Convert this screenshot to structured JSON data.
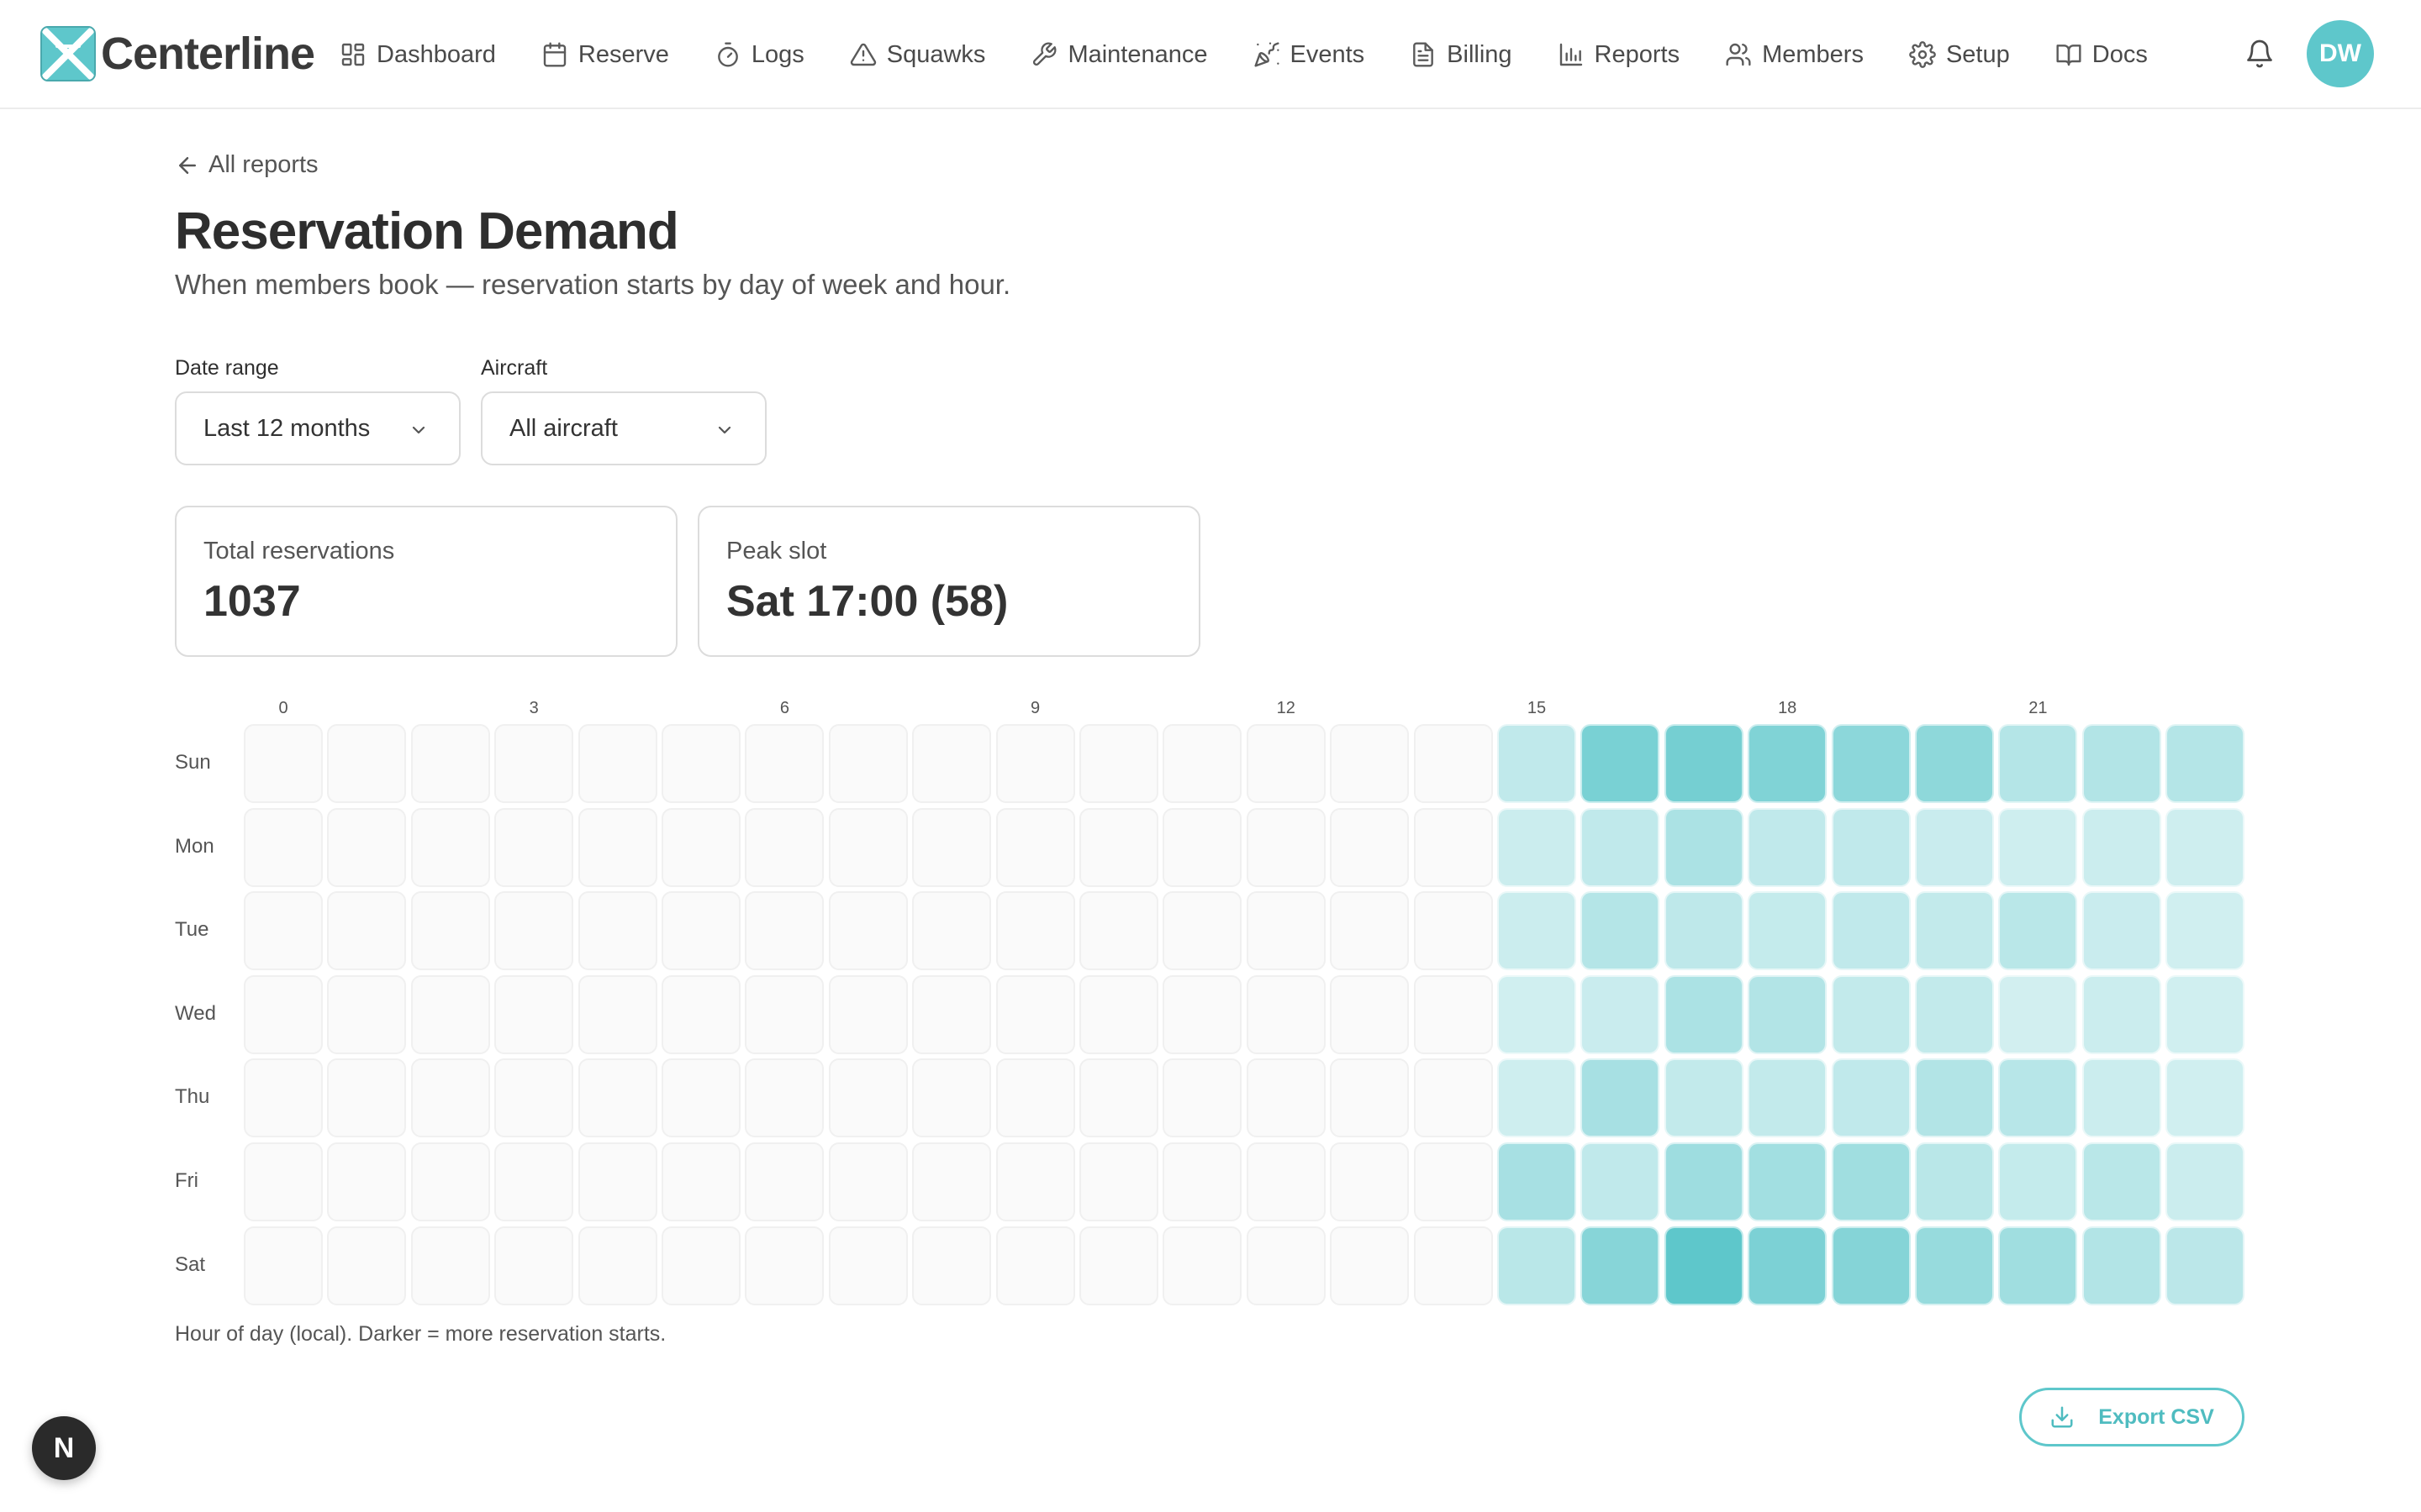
{
  "brand": {
    "name": "Centerline",
    "accent": "#5ec7cb"
  },
  "nav": {
    "items": [
      {
        "label": "Dashboard",
        "icon": "grid-icon"
      },
      {
        "label": "Reserve",
        "icon": "calendar-icon"
      },
      {
        "label": "Logs",
        "icon": "stopwatch-icon"
      },
      {
        "label": "Squawks",
        "icon": "warning-triangle-icon"
      },
      {
        "label": "Maintenance",
        "icon": "wrench-icon"
      },
      {
        "label": "Events",
        "icon": "party-popper-icon"
      },
      {
        "label": "Billing",
        "icon": "receipt-icon"
      },
      {
        "label": "Reports",
        "icon": "bar-chart-icon"
      },
      {
        "label": "Members",
        "icon": "users-icon"
      },
      {
        "label": "Setup",
        "icon": "gear-icon"
      },
      {
        "label": "Docs",
        "icon": "book-icon"
      }
    ],
    "avatar_initials": "DW"
  },
  "page": {
    "back_label": "All reports",
    "title": "Reservation Demand",
    "subtitle": "When members book — reservation starts by day of week and hour."
  },
  "filters": {
    "date_range": {
      "label": "Date range",
      "value": "Last 12 months"
    },
    "aircraft": {
      "label": "Aircraft",
      "value": "All aircraft"
    }
  },
  "stats": {
    "total": {
      "label": "Total reservations",
      "value": "1037"
    },
    "peak": {
      "label": "Peak slot",
      "value": "Sat 17:00 (58)"
    }
  },
  "chart_data": {
    "type": "heatmap",
    "x_tick_labels": [
      "0",
      "3",
      "6",
      "9",
      "12",
      "15",
      "18",
      "21"
    ],
    "hours": [
      0,
      1,
      2,
      3,
      4,
      5,
      6,
      7,
      8,
      9,
      10,
      11,
      12,
      13,
      14,
      15,
      16,
      17,
      18,
      19,
      20,
      21,
      22,
      23
    ],
    "days": [
      "Sun",
      "Mon",
      "Tue",
      "Wed",
      "Thu",
      "Fri",
      "Sat"
    ],
    "values": [
      [
        0,
        0,
        0,
        0,
        0,
        0,
        0,
        0,
        0,
        0,
        0,
        0,
        0,
        0,
        0,
        15,
        46,
        48,
        43,
        38,
        37,
        20,
        21,
        20
      ],
      [
        0,
        0,
        0,
        0,
        0,
        0,
        0,
        0,
        0,
        0,
        0,
        0,
        0,
        0,
        0,
        10,
        15,
        24,
        15,
        15,
        11,
        9,
        10,
        9
      ],
      [
        0,
        0,
        0,
        0,
        0,
        0,
        0,
        0,
        0,
        0,
        0,
        0,
        0,
        0,
        0,
        10,
        20,
        16,
        13,
        15,
        14,
        18,
        11,
        8
      ],
      [
        0,
        0,
        0,
        0,
        0,
        0,
        0,
        0,
        0,
        0,
        0,
        0,
        0,
        0,
        0,
        8,
        11,
        24,
        21,
        14,
        14,
        7,
        10,
        8
      ],
      [
        0,
        0,
        0,
        0,
        0,
        0,
        0,
        0,
        0,
        0,
        0,
        0,
        0,
        0,
        0,
        9,
        26,
        14,
        14,
        15,
        21,
        19,
        10,
        8
      ],
      [
        0,
        0,
        0,
        0,
        0,
        0,
        0,
        0,
        0,
        0,
        0,
        0,
        0,
        0,
        0,
        26,
        15,
        30,
        28,
        29,
        18,
        13,
        18,
        10
      ],
      [
        0,
        0,
        0,
        0,
        0,
        0,
        0,
        0,
        0,
        0,
        0,
        0,
        0,
        0,
        0,
        18,
        40,
        58,
        45,
        41,
        33,
        29,
        21,
        17
      ]
    ],
    "max": 58,
    "footnote": "Hour of day (local). Darker = more reservation starts."
  },
  "export": {
    "label": "Export CSV",
    "icon": "download-icon"
  },
  "devtools": {
    "label": "N"
  }
}
